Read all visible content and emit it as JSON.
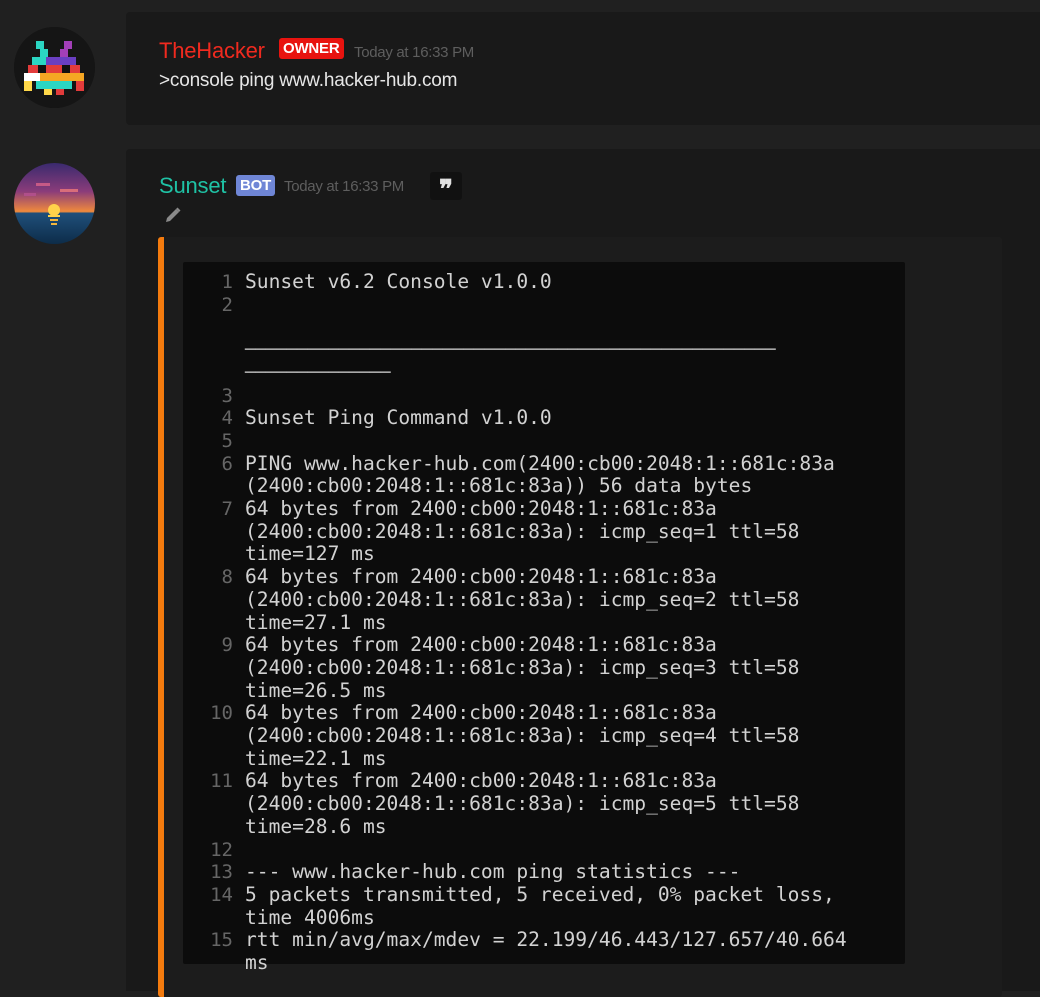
{
  "messages": [
    {
      "username": "TheHacker",
      "badge": "OWNER",
      "timestamp": "Today at 16:33 PM",
      "content": ">console ping www.hacker-hub.com",
      "name_color": "#f02a1f",
      "badge_color": "#e8130f"
    },
    {
      "username": "Sunset",
      "badge": "BOT",
      "timestamp": "Today at 16:33 PM",
      "name_color": "#1fc2a5",
      "badge_color": "#6f86d6",
      "embed_color": "#f47b0e"
    }
  ],
  "icons": {
    "quote": "quote-icon",
    "edit": "pencil-icon",
    "quote_glyph": "❞"
  },
  "code_block": {
    "lines": [
      {
        "n": "1",
        "text": [
          "Sunset v6.2 Console v1.0.0"
        ]
      },
      {
        "n": "2",
        "text": [
          "",
          "",
          "───────────────────────────────────────────────────",
          "──────────────"
        ]
      },
      {
        "n": "3",
        "text": [
          ""
        ]
      },
      {
        "n": "4",
        "text": [
          "Sunset Ping Command v1.0.0"
        ]
      },
      {
        "n": "5",
        "text": [
          ""
        ]
      },
      {
        "n": "6",
        "text": [
          "PING www.hacker-hub.com(2400:cb00:2048:1::681c:83a",
          "(2400:cb00:2048:1::681c:83a)) 56 data bytes"
        ]
      },
      {
        "n": "7",
        "text": [
          "64 bytes from 2400:cb00:2048:1::681c:83a",
          "(2400:cb00:2048:1::681c:83a): icmp_seq=1 ttl=58",
          "time=127 ms"
        ]
      },
      {
        "n": "8",
        "text": [
          "64 bytes from 2400:cb00:2048:1::681c:83a",
          "(2400:cb00:2048:1::681c:83a): icmp_seq=2 ttl=58",
          "time=27.1 ms"
        ]
      },
      {
        "n": "9",
        "text": [
          "64 bytes from 2400:cb00:2048:1::681c:83a",
          "(2400:cb00:2048:1::681c:83a): icmp_seq=3 ttl=58",
          "time=26.5 ms"
        ]
      },
      {
        "n": "10",
        "text": [
          "64 bytes from 2400:cb00:2048:1::681c:83a",
          "(2400:cb00:2048:1::681c:83a): icmp_seq=4 ttl=58",
          "time=22.1 ms"
        ]
      },
      {
        "n": "11",
        "text": [
          "64 bytes from 2400:cb00:2048:1::681c:83a",
          "(2400:cb00:2048:1::681c:83a): icmp_seq=5 ttl=58",
          "time=28.6 ms"
        ]
      },
      {
        "n": "12",
        "text": [
          ""
        ]
      },
      {
        "n": "13",
        "text": [
          "--- www.hacker-hub.com ping statistics ---"
        ]
      },
      {
        "n": "14",
        "text": [
          "5 packets transmitted, 5 received, 0% packet loss,",
          "time 4006ms"
        ]
      },
      {
        "n": "15",
        "text": [
          "rtt min/avg/max/mdev = 22.199/46.443/127.657/40.664",
          "ms"
        ]
      }
    ]
  }
}
